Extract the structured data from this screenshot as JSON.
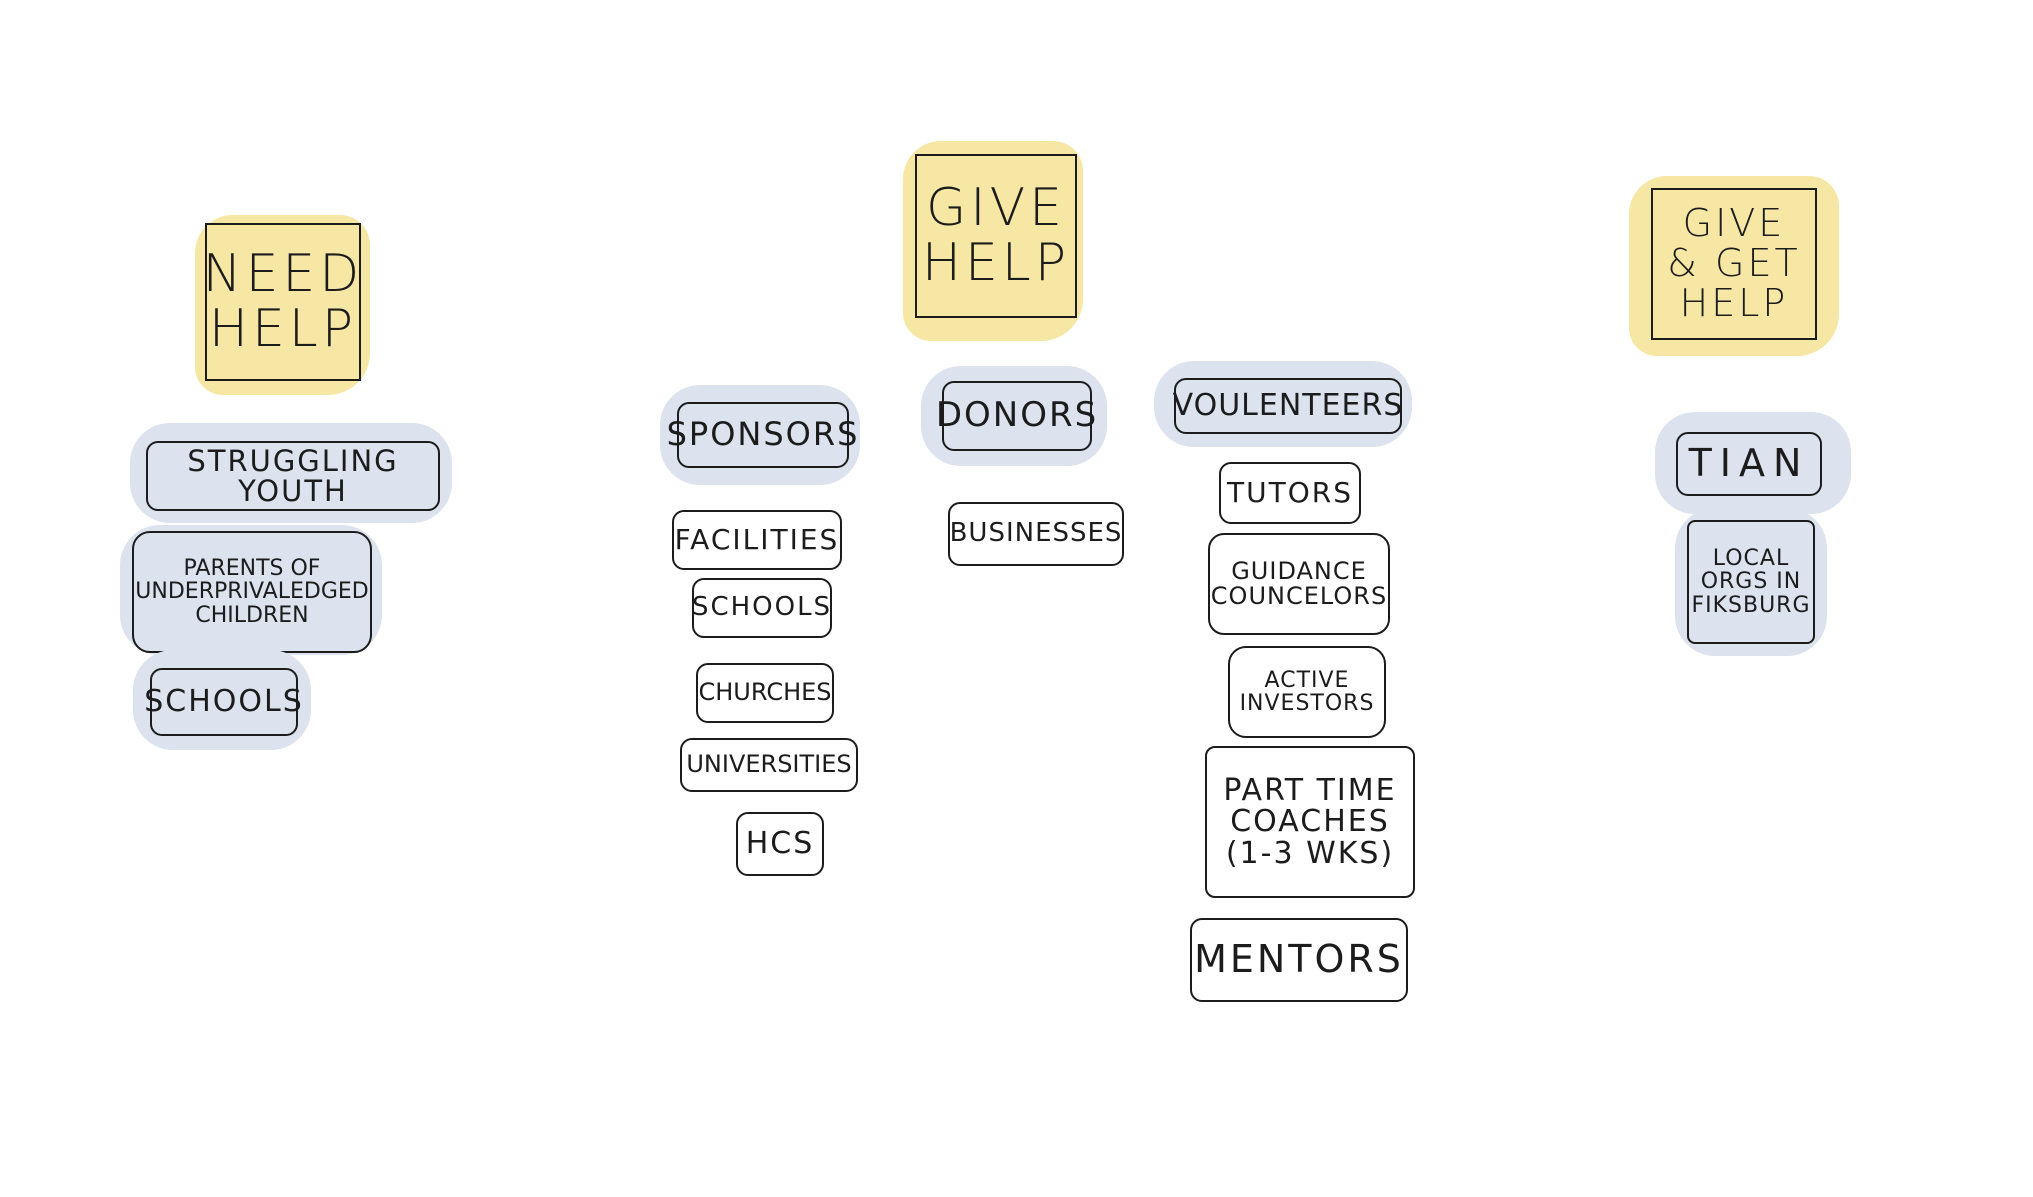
{
  "columns": {
    "need_help": {
      "header": "NEED\nHELP",
      "items": [
        "STRUGGLING YOUTH",
        "PARENTS OF\nUNDERPRIVALEDGED\nCHILDREN",
        "SCHOOLS"
      ]
    },
    "give_help": {
      "header": "GIVE\nHELP",
      "sponsors": {
        "label": "SPONSORS",
        "items": [
          "FACILITIES",
          "SCHOOLS",
          "CHURCHES",
          "UNIVERSITIES",
          "HCS"
        ]
      },
      "donors": {
        "label": "DONORS",
        "items": [
          "BUSINESSES"
        ]
      },
      "volunteers": {
        "label": "VOULENTEERS",
        "items": [
          "TUTORS",
          "GUIDANCE\nCOUNCELORS",
          "ACTIVE\nINVESTORS",
          "PART TIME\nCOACHES\n(1-3 WKS)",
          "MENTORS"
        ]
      }
    },
    "give_get_help": {
      "header": "GIVE\n& GET\nHELP",
      "items": [
        "TIAN",
        "LOCAL\nORGS IN\nFIKSBURG"
      ]
    }
  },
  "colors": {
    "sticky": "#f6e7a4",
    "highlight": "#dce3ee",
    "ink": "#1c1c1c"
  }
}
